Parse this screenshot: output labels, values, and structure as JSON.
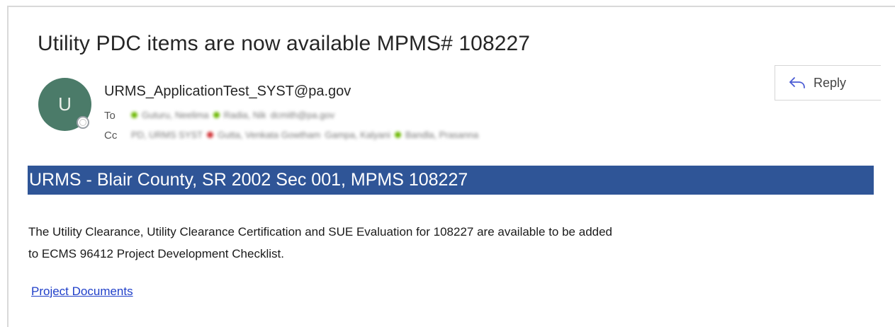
{
  "email": {
    "subject": "Utility PDC items are now available MPMS# 108227",
    "avatar_initial": "U",
    "sender": "URMS_ApplicationTest_SYST@pa.gov",
    "to_label": "To",
    "cc_label": "Cc",
    "to_recipients": [
      "Guturu, Neelima",
      "Radia, Nik",
      "dcmith@pa.gov"
    ],
    "cc_recipients": [
      "PD, URMS SYST",
      "Gutta, Venkata Gowtham",
      "Gampa, Kalyani",
      "Bandla, Prasanna"
    ],
    "reply_label": "Reply"
  },
  "body": {
    "banner": "URMS - Blair County, SR 2002 Sec 001, MPMS 108227",
    "paragraph_line1": "The Utility Clearance, Utility Clearance Certification and SUE Evaluation for 108227 are available to be added",
    "paragraph_line2": "to ECMS 96412 Project Development Checklist.",
    "link": "Project Documents"
  },
  "colors": {
    "banner_bg": "#2f5597",
    "avatar_bg": "#4b7b69",
    "link": "#1f3fc9",
    "presence_green": "#6bb700",
    "presence_red": "#d13438"
  },
  "icons": {
    "reply": "reply-arrow-icon",
    "presence": "presence-status-icon"
  }
}
